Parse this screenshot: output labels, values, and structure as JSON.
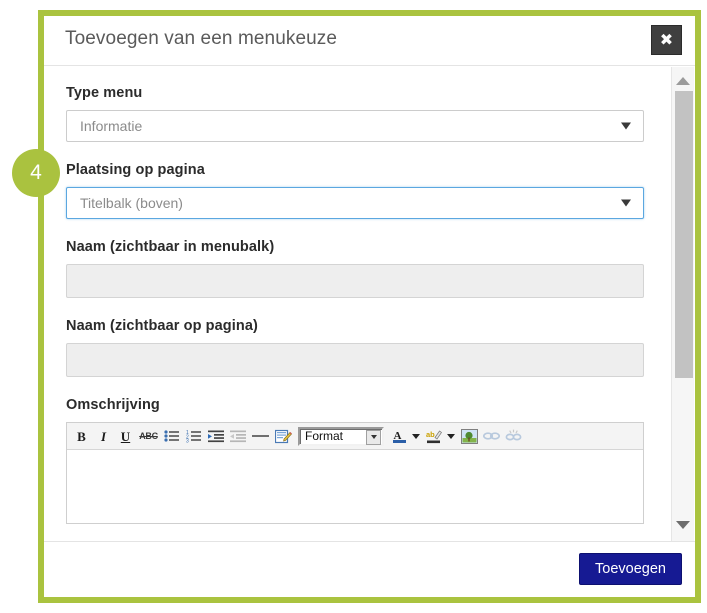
{
  "modal": {
    "title": "Toevoegen van een menukeuze",
    "close_label": "✖",
    "close_icon": "close-icon"
  },
  "step_badge": {
    "number": "4"
  },
  "form": {
    "fields": [
      {
        "label": "Type menu",
        "type": "select",
        "value": "Informatie",
        "focused": false
      },
      {
        "label": "Plaatsing op pagina",
        "type": "select",
        "value": "Titelbalk (boven)",
        "focused": true
      },
      {
        "label": "Naam (zichtbaar in menubalk)",
        "type": "text",
        "value": "",
        "placeholder": ""
      },
      {
        "label": "Naam (zichtbaar op pagina)",
        "type": "text",
        "value": "",
        "placeholder": ""
      },
      {
        "label": "Omschrijving",
        "type": "richtext",
        "value": ""
      }
    ]
  },
  "editor": {
    "toolbar": {
      "bold": "B",
      "italic": "I",
      "underline": "U",
      "strikethrough": "ABC",
      "format_label": "Format"
    }
  },
  "footer": {
    "submit_label": "Toevoegen"
  },
  "scrollbar": {
    "up_arrow": "▲",
    "down_arrow": "▼"
  },
  "colors": {
    "accent_green": "#aac23f",
    "submit_blue": "#161a93",
    "focus_blue": "#5ba7e0",
    "close_dark": "#3f3f3f"
  }
}
